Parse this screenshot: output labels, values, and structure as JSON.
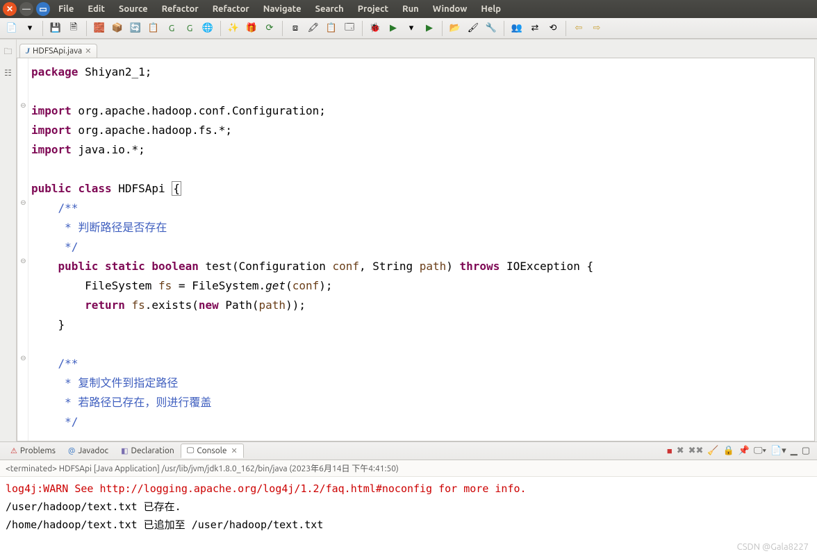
{
  "window": {
    "menus": [
      "File",
      "Edit",
      "Source",
      "Refactor",
      "Refactor",
      "Navigate",
      "Search",
      "Project",
      "Run",
      "Window",
      "Help"
    ]
  },
  "tab": {
    "filename": "HDFSApi.java"
  },
  "code": {
    "lines": [
      {
        "indent": 0,
        "tokens": [
          [
            "kw",
            "package"
          ],
          [
            "",
            " Shiyan2_1;"
          ]
        ]
      },
      {
        "indent": 0,
        "tokens": []
      },
      {
        "fold": "⊖",
        "indent": 0,
        "tokens": [
          [
            "kw",
            "import"
          ],
          [
            "",
            " org.apache.hadoop.conf.Configuration;"
          ]
        ]
      },
      {
        "indent": 0,
        "tokens": [
          [
            "kw",
            "import"
          ],
          [
            "",
            " org.apache.hadoop.fs.*;"
          ]
        ]
      },
      {
        "indent": 0,
        "tokens": [
          [
            "kw",
            "import"
          ],
          [
            "",
            " java.io.*;"
          ]
        ]
      },
      {
        "indent": 0,
        "tokens": []
      },
      {
        "indent": 0,
        "tokens": [
          [
            "kw",
            "public"
          ],
          [
            "",
            " "
          ],
          [
            "kw",
            "class"
          ],
          [
            "",
            " HDFSApi "
          ],
          [
            "mbox",
            "{"
          ]
        ]
      },
      {
        "fold": "⊖",
        "indent": 1,
        "tokens": [
          [
            "cmt",
            "/**"
          ]
        ]
      },
      {
        "indent": 1,
        "tokens": [
          [
            "cmt",
            " * 判断路径是否存在"
          ]
        ]
      },
      {
        "indent": 1,
        "tokens": [
          [
            "cmt",
            " */"
          ]
        ]
      },
      {
        "fold": "⊖",
        "indent": 1,
        "tokens": [
          [
            "kw",
            "public"
          ],
          [
            "",
            " "
          ],
          [
            "kw",
            "static"
          ],
          [
            "",
            " "
          ],
          [
            "kw",
            "boolean"
          ],
          [
            "",
            " test(Configuration "
          ],
          [
            "param",
            "conf"
          ],
          [
            "",
            ", String "
          ],
          [
            "param",
            "path"
          ],
          [
            "",
            ") "
          ],
          [
            "kw",
            "throws"
          ],
          [
            "",
            " IOException {"
          ]
        ]
      },
      {
        "indent": 2,
        "tokens": [
          [
            "",
            "FileSystem "
          ],
          [
            "param",
            "fs"
          ],
          [
            "",
            " = FileSystem."
          ],
          [
            "i",
            "get"
          ],
          [
            "",
            "("
          ],
          [
            "param",
            "conf"
          ],
          [
            "",
            ");"
          ]
        ]
      },
      {
        "indent": 2,
        "tokens": [
          [
            "kw",
            "return"
          ],
          [
            "",
            " "
          ],
          [
            "param",
            "fs"
          ],
          [
            "",
            ".exists("
          ],
          [
            "kw",
            "new"
          ],
          [
            "",
            " Path("
          ],
          [
            "param",
            "path"
          ],
          [
            "",
            "));"
          ]
        ]
      },
      {
        "indent": 1,
        "tokens": [
          [
            "",
            "}"
          ]
        ]
      },
      {
        "indent": 0,
        "tokens": []
      },
      {
        "fold": "⊖",
        "indent": 1,
        "tokens": [
          [
            "cmt",
            "/**"
          ]
        ]
      },
      {
        "indent": 1,
        "tokens": [
          [
            "cmt",
            " * 复制文件到指定路径"
          ]
        ]
      },
      {
        "indent": 1,
        "tokens": [
          [
            "cmt",
            " * 若路径已存在，则进行覆盖"
          ]
        ]
      },
      {
        "indent": 1,
        "tokens": [
          [
            "cmt",
            " */"
          ]
        ]
      }
    ]
  },
  "bottom": {
    "tabs": {
      "problems": "Problems",
      "javadoc": "Javadoc",
      "declaration": "Declaration",
      "console": "Console"
    },
    "console_header": "<terminated> HDFSApi [Java Application] /usr/lib/jvm/jdk1.8.0_162/bin/java (2023年6月14日 下午4:41:50)",
    "output": [
      {
        "cls": "warn",
        "text": "log4j:WARN See http://logging.apache.org/log4j/1.2/faq.html#noconfig for more info."
      },
      {
        "cls": "",
        "text": "/user/hadoop/text.txt 已存在."
      },
      {
        "cls": "",
        "text": "/home/hadoop/text.txt 已追加至 /user/hadoop/text.txt"
      }
    ]
  },
  "watermark": "CSDN @Gala8227"
}
